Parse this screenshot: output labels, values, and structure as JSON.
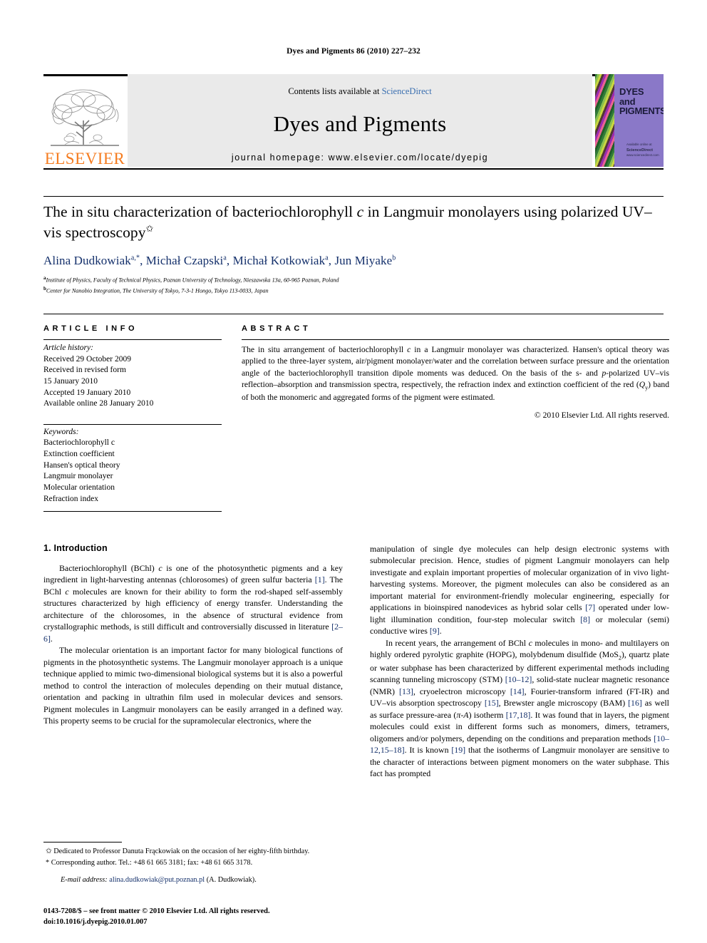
{
  "running_head": "Dyes and Pigments 86 (2010) 227–232",
  "journal_header": {
    "publisher_name": "ELSEVIER",
    "contents_prefix": "Contents lists available at ",
    "contents_link": "ScienceDirect",
    "journal_title": "Dyes and Pigments",
    "homepage_line": "journal homepage: www.elsevier.com/locate/dyepig",
    "cover_title_lines": [
      "DYES",
      "and",
      "PIGMENTS"
    ],
    "cover_foot_small": "Available online at",
    "cover_foot_sd": "ScienceDirect",
    "cover_foot_url": "www.sciencedirect.com",
    "accent_orange": "#F57C20",
    "band_gray": "#eaeaea",
    "link_blue": "#3a6fb0"
  },
  "article": {
    "title_line1_a": "The in situ characterization of bacteriochlorophyll ",
    "title_line1_italic": "c",
    "title_line1_b": " in Langmuir monolayers",
    "title_line2": "using polarized UV–vis spectroscopy",
    "title_star": "✩",
    "authors_html": "Alina Dudkowiak, Michał Czapski, Michał Kotkowiak, Jun Miyake",
    "authors": [
      {
        "name": "Alina Dudkowiak",
        "sup": "a,*"
      },
      {
        "name": "Michał Czapski",
        "sup": "a"
      },
      {
        "name": "Michał Kotkowiak",
        "sup": "a"
      },
      {
        "name": "Jun Miyake",
        "sup": "b"
      }
    ],
    "affiliations": [
      {
        "mark": "a",
        "text": "Institute of Physics, Faculty of Technical Physics, Poznan University of Technology, Nieszawska 13a, 60-965 Poznan, Poland"
      },
      {
        "mark": "b",
        "text": "Center for Nanobio Integration, The University of Tokyo, 7-3-1 Hongo, Tokyo 113-0033, Japan"
      }
    ],
    "author_color": "#14306b"
  },
  "article_info": {
    "heading": "ARTICLE INFO",
    "history_label": "Article history:",
    "history_lines": [
      "Received 29 October 2009",
      "Received in revised form",
      "15 January 2010",
      "Accepted 19 January 2010",
      "Available online 28 January 2010"
    ],
    "keywords_label": "Keywords:",
    "keywords": [
      "Bacteriochlorophyll c",
      "Extinction coefficient",
      "Hansen's optical theory",
      "Langmuir monolayer",
      "Molecular orientation",
      "Refraction index"
    ]
  },
  "abstract": {
    "heading": "ABSTRACT",
    "paragraph_parts": [
      {
        "t": "The in situ arrangement of bacteriochlorophyll "
      },
      {
        "t": "c",
        "i": true
      },
      {
        "t": " in a Langmuir monolayer was characterized. Hansen's optical theory was applied to the three-layer system, air/pigment monolayer/water and the correlation between surface pressure and the orientation angle of the bacteriochlorophyll transition dipole moments was deduced. On the basis of the s- and "
      },
      {
        "t": "p",
        "i": true
      },
      {
        "t": "-polarized UV–vis reflection–absorption and transmission spectra, respectively, the refraction index and extinction coefficient of the red ("
      },
      {
        "t": "Q",
        "i": true
      },
      {
        "t": "y",
        "sub": true
      },
      {
        "t": ") band of both the monomeric and aggregated forms of the pigment were estimated."
      }
    ],
    "copyright": "© 2010 Elsevier Ltd. All rights reserved."
  },
  "body": {
    "section_heading": "1. Introduction",
    "left_paragraphs": [
      [
        {
          "t": "Bacteriochlorophyll (BChl) "
        },
        {
          "t": "c",
          "i": true
        },
        {
          "t": " is one of the photosynthetic pigments and a key ingredient in light-harvesting antennas (chlorosomes) of green sulfur bacteria "
        },
        {
          "t": "[1]",
          "ref": true
        },
        {
          "t": ". The BChl "
        },
        {
          "t": "c",
          "i": true
        },
        {
          "t": " molecules are known for their ability to form the rod-shaped self-assembly structures characterized by high efficiency of energy transfer. Understanding the architecture of the chlorosomes, in the absence of structural evidence from crystallographic methods, is still difficult and controversially discussed in literature "
        },
        {
          "t": "[2–6]",
          "ref": true
        },
        {
          "t": "."
        }
      ],
      [
        {
          "t": "The molecular orientation is an important factor for many biological functions of pigments in the photosynthetic systems. The Langmuir monolayer approach is a unique technique applied to mimic two-dimensional biological systems but it is also a powerful method to control the interaction of molecules depending on their mutual distance, orientation and packing in ultrathin film used in molecular devices and sensors. Pigment molecules in Langmuir monolayers can be easily arranged in a defined way. This property seems to be crucial for the supramolecular electronics, where the"
        }
      ]
    ],
    "right_paragraphs": [
      [
        {
          "t": "manipulation of single dye molecules can help design electronic systems with submolecular precision. Hence, studies of pigment Langmuir monolayers can help investigate and explain important properties of molecular organization of in vivo light-harvesting systems. Moreover, the pigment molecules can also be considered as an important material for environment-friendly molecular engineering, especially for applications in bioinspired nanodevices as hybrid solar cells "
        },
        {
          "t": "[7]",
          "ref": true
        },
        {
          "t": " operated under low-light illumination condition, four-step molecular switch "
        },
        {
          "t": "[8]",
          "ref": true
        },
        {
          "t": " or molecular (semi) conductive wires "
        },
        {
          "t": "[9]",
          "ref": true
        },
        {
          "t": "."
        }
      ],
      [
        {
          "t": "In recent years, the arrangement of BChl "
        },
        {
          "t": "c",
          "i": true
        },
        {
          "t": " molecules in mono- and multilayers on highly ordered pyrolytic graphite (HOPG), molybdenum disulfide (MoS"
        },
        {
          "t": "2",
          "sub": true
        },
        {
          "t": "), quartz plate or water subphase has been characterized by different experimental methods including scanning tunneling microscopy (STM) "
        },
        {
          "t": "[10–12]",
          "ref": true
        },
        {
          "t": ", solid-state nuclear magnetic resonance (NMR) "
        },
        {
          "t": "[13]",
          "ref": true
        },
        {
          "t": ", cryoelectron microscopy "
        },
        {
          "t": "[14]",
          "ref": true
        },
        {
          "t": ", Fourier-transform infrared (FT-IR) and UV–vis absorption spectroscopy "
        },
        {
          "t": "[15]",
          "ref": true
        },
        {
          "t": ", Brewster angle microscopy (BAM) "
        },
        {
          "t": "[16]",
          "ref": true
        },
        {
          "t": " as well as surface pressure-area ("
        },
        {
          "t": "π-A",
          "i": true
        },
        {
          "t": ") isotherm "
        },
        {
          "t": "[17,18]",
          "ref": true
        },
        {
          "t": ". It was found that in layers, the pigment molecules could exist in different forms such as monomers, dimers, tetramers, oligomers and/or polymers, depending on the conditions and preparation methods "
        },
        {
          "t": "[10–12,15–18]",
          "ref": true
        },
        {
          "t": ". It is known "
        },
        {
          "t": "[19]",
          "ref": true
        },
        {
          "t": " that the isotherms of Langmuir monolayer are sensitive to the character of interactions between pigment monomers on the water subphase. This fact has prompted"
        }
      ]
    ]
  },
  "footnotes": {
    "dedication_mark": "✩",
    "dedication_text": "Dedicated to Professor Danuta Frąckowiak on the occasion of her eighty-fifth birthday.",
    "corresponding_mark": "*",
    "corresponding_text": "Corresponding author. Tel.: +48 61 665 3181; fax: +48 61 665 3178.",
    "email_label": "E-mail address:",
    "email": "alina.dudkowiak@put.poznan.pl",
    "email_owner": "(A. Dudkowiak).",
    "link_color": "#14306b"
  },
  "imprint": {
    "line1": "0143-7208/$ – see front matter © 2010 Elsevier Ltd. All rights reserved.",
    "line2": "doi:10.1016/j.dyepig.2010.01.007"
  }
}
